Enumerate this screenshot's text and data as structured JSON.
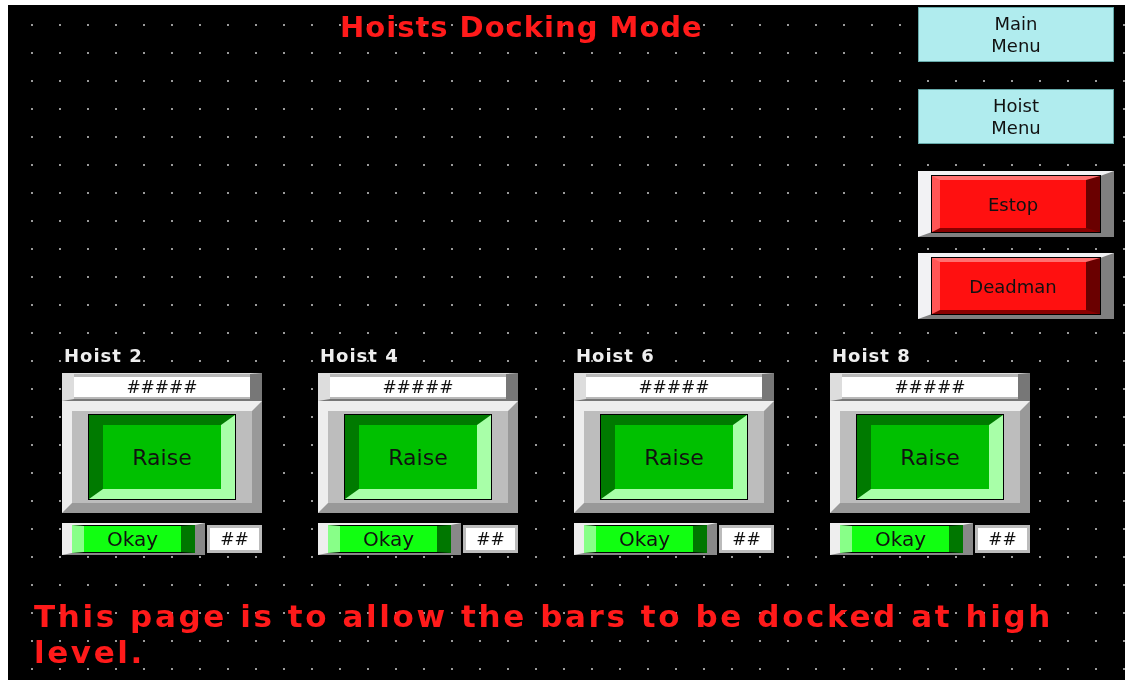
{
  "title": "Hoists Docking Mode",
  "side_buttons": [
    {
      "kind": "menu",
      "label": "Main Menu"
    },
    {
      "kind": "menu",
      "label": "Hoist Menu"
    },
    {
      "kind": "alarm",
      "label": "Estop"
    },
    {
      "kind": "alarm",
      "label": "Deadman"
    }
  ],
  "hoists": [
    {
      "name": "Hoist 2",
      "value": "#####",
      "button": "Raise",
      "status": "Okay",
      "count": "##"
    },
    {
      "name": "Hoist 4",
      "value": "#####",
      "button": "Raise",
      "status": "Okay",
      "count": "##"
    },
    {
      "name": "Hoist 6",
      "value": "#####",
      "button": "Raise",
      "status": "Okay",
      "count": "##"
    },
    {
      "name": "Hoist 8",
      "value": "#####",
      "button": "Raise",
      "status": "Okay",
      "count": "##"
    }
  ],
  "footer": "This page is to allow the bars to be docked at high level."
}
